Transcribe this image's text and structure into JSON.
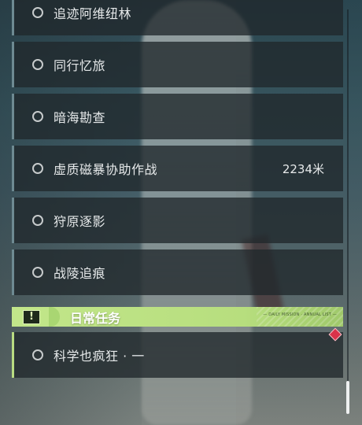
{
  "quests": [
    {
      "label": "追迹阿维纽林",
      "distance": ""
    },
    {
      "label": "同行忆旅",
      "distance": ""
    },
    {
      "label": "暗海勘查",
      "distance": ""
    },
    {
      "label": "虚质磁暴协助作战",
      "distance": "2234米"
    },
    {
      "label": "狩原逐影",
      "distance": ""
    },
    {
      "label": "战陵追痕",
      "distance": ""
    }
  ],
  "daily_section": {
    "title": "日常任务",
    "icon": "exclamation-icon",
    "icon_glyph": "!",
    "tiny_text": "— DAILY MISSION · ANNUAL LIST —",
    "accent_color": "#b9dc82"
  },
  "daily_quests": [
    {
      "label": "科学也疯狂 · 一"
    }
  ],
  "marker": {
    "icon": "red-diamond-icon",
    "color": "#d8334a"
  }
}
